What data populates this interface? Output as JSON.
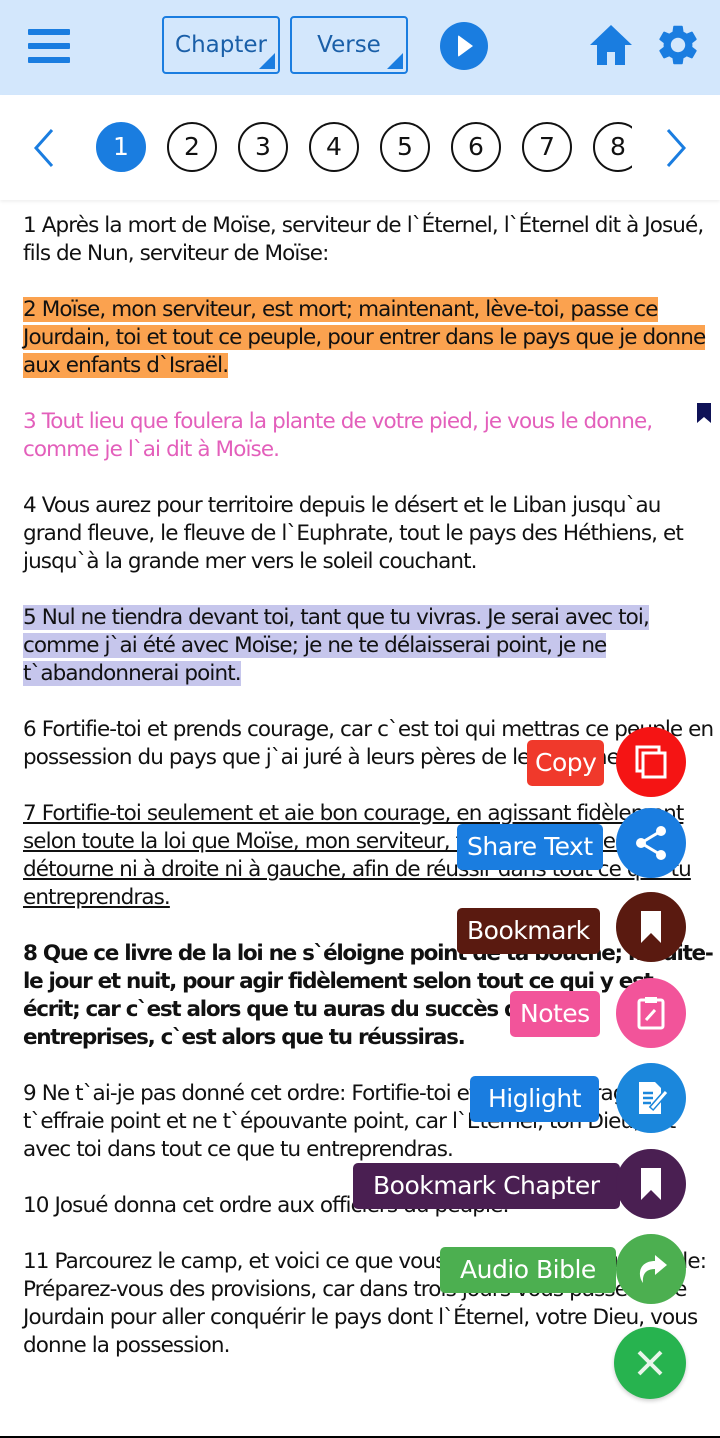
{
  "toolbar": {
    "menu_icon": "hamburger-menu-icon",
    "chapter_select_label": "Chapter",
    "verse_select_label": "Verse",
    "play_icon": "play-icon",
    "home_icon": "home-icon",
    "settings_icon": "gear-icon",
    "accent_color": "#1a7de0",
    "background_color": "#d3e7fc"
  },
  "chapter_nav": {
    "prev_icon": "chevron-left-icon",
    "next_icon": "chevron-right-icon",
    "active_chapter": "1",
    "chapters": [
      "1",
      "2",
      "3",
      "4",
      "5",
      "6",
      "7",
      "8"
    ]
  },
  "verses": [
    {
      "text": "1 Après la mort de Moïse, serviteur de l`Éternel, l`Éternel dit à Josué, fils de Nun, serviteur de Moïse:",
      "style": "normal"
    },
    {
      "text": "2 Moïse, mon serviteur, est mort; maintenant, lève-toi, passe ce Jourdain, toi et tout ce peuple, pour entrer dans le pays que je donne aux enfants d`Israël.",
      "style": "highlight-orange",
      "color": "#fba24f"
    },
    {
      "text": "3 Tout lieu que foulera la plante de votre pied, je vous le donne, comme je l`ai dit à Moïse.",
      "style": "text-pink",
      "color": "#e35fbb",
      "bookmarked": true
    },
    {
      "text": "4 Vous aurez pour territoire depuis le désert et le Liban jusqu`au grand fleuve, le fleuve de l`Euphrate, tout le pays des Héthiens, et jusqu`à la grande mer vers le soleil couchant.",
      "style": "normal"
    },
    {
      "text": "5 Nul ne tiendra devant toi, tant que tu vivras. Je serai avec toi, comme j`ai été avec Moïse; je ne te délaisserai point, je ne t`abandonnerai point.",
      "style": "highlight-purple",
      "color": "#c6c6ec"
    },
    {
      "text": "6 Fortifie-toi et prends courage, car c`est toi qui mettras ce peuple en possession du pays que j`ai juré à leurs pères de leur donner.",
      "style": "normal"
    },
    {
      "text": "7 Fortifie-toi seulement et aie bon courage, en agissant fidèlement selon toute la loi que Moïse, mon serviteur, t`a prescrite; ne t`en détourne ni à droite ni à gauche, afin de réussir dans tout ce que tu entreprendras.",
      "style": "underline"
    },
    {
      "text": "8 Que ce livre de la loi ne s`éloigne point de ta bouche; médite-le jour et nuit, pour agir fidèlement selon tout ce qui y est écrit; car c`est alors que tu auras du succès dans tes entreprises, c`est alors que tu réussiras.",
      "style": "bold"
    },
    {
      "text": "9 Ne t`ai-je pas donné cet ordre: Fortifie-toi et prends courage? Ne t`effraie point et ne t`épouvante point, car l`Éternel, ton Dieu, est avec toi dans tout ce que tu entreprendras.",
      "style": "normal"
    },
    {
      "text": "10 Josué donna cet ordre aux officiers du peuple:",
      "style": "normal"
    },
    {
      "text": "11 Parcourez le camp, et voici ce que vous commanderez au peuple: Préparez-vous des provisions, car dans trois jours vous passerez ce Jourdain pour aller conquérir le pays dont l`Éternel, votre Dieu, vous donne la possession.",
      "style": "normal"
    }
  ],
  "fab_menu": {
    "actions": [
      {
        "label": "Copy",
        "icon": "copy-icon",
        "color": "#f51414",
        "label_color": "#f0392b"
      },
      {
        "label": "Share Text",
        "icon": "share-icon",
        "color": "#1a7de0",
        "label_color": "#1a7de0"
      },
      {
        "label": "Bookmark",
        "icon": "bookmark-icon",
        "color": "#5a1a10",
        "label_color": "#5a1a10"
      },
      {
        "label": "Notes",
        "icon": "clipboard-edit-icon",
        "color": "#f2549a",
        "label_color": "#f2549a"
      },
      {
        "label": "Higlight",
        "icon": "document-edit-icon",
        "color": "#1b87dc",
        "label_color": "#1a7de0"
      },
      {
        "label": "Bookmark Chapter",
        "icon": "bookmark-icon",
        "color": "#4a1f52",
        "label_color": "#4a1f52"
      },
      {
        "label": "Audio Bible",
        "icon": "forward-arrow-icon",
        "color": "#4caf50",
        "label_color": "#4caf50"
      }
    ],
    "close_icon": "close-icon",
    "close_color": "#27b34f"
  }
}
